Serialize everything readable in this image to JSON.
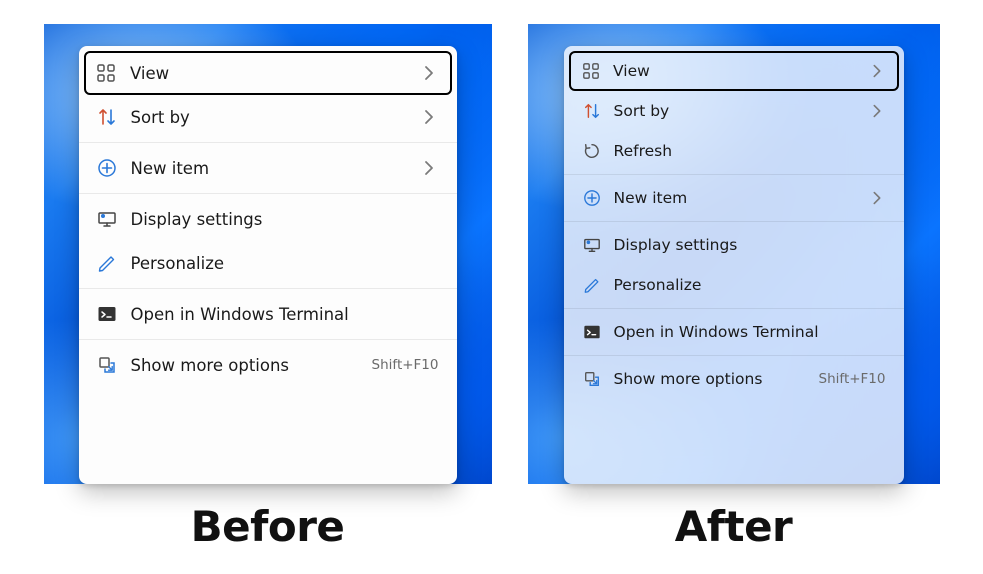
{
  "labels": {
    "before": "Before",
    "after": "After"
  },
  "menu_before": {
    "view": "View",
    "sort_by": "Sort by",
    "new_item": "New item",
    "display_settings": "Display settings",
    "personalize": "Personalize",
    "open_terminal": "Open in Windows Terminal",
    "show_more": "Show more options",
    "show_more_shortcut": "Shift+F10"
  },
  "menu_after": {
    "view": "View",
    "sort_by": "Sort by",
    "refresh": "Refresh",
    "new_item": "New item",
    "display_settings": "Display settings",
    "personalize": "Personalize",
    "open_terminal": "Open in Windows Terminal",
    "show_more": "Show more options",
    "show_more_shortcut": "Shift+F10"
  }
}
